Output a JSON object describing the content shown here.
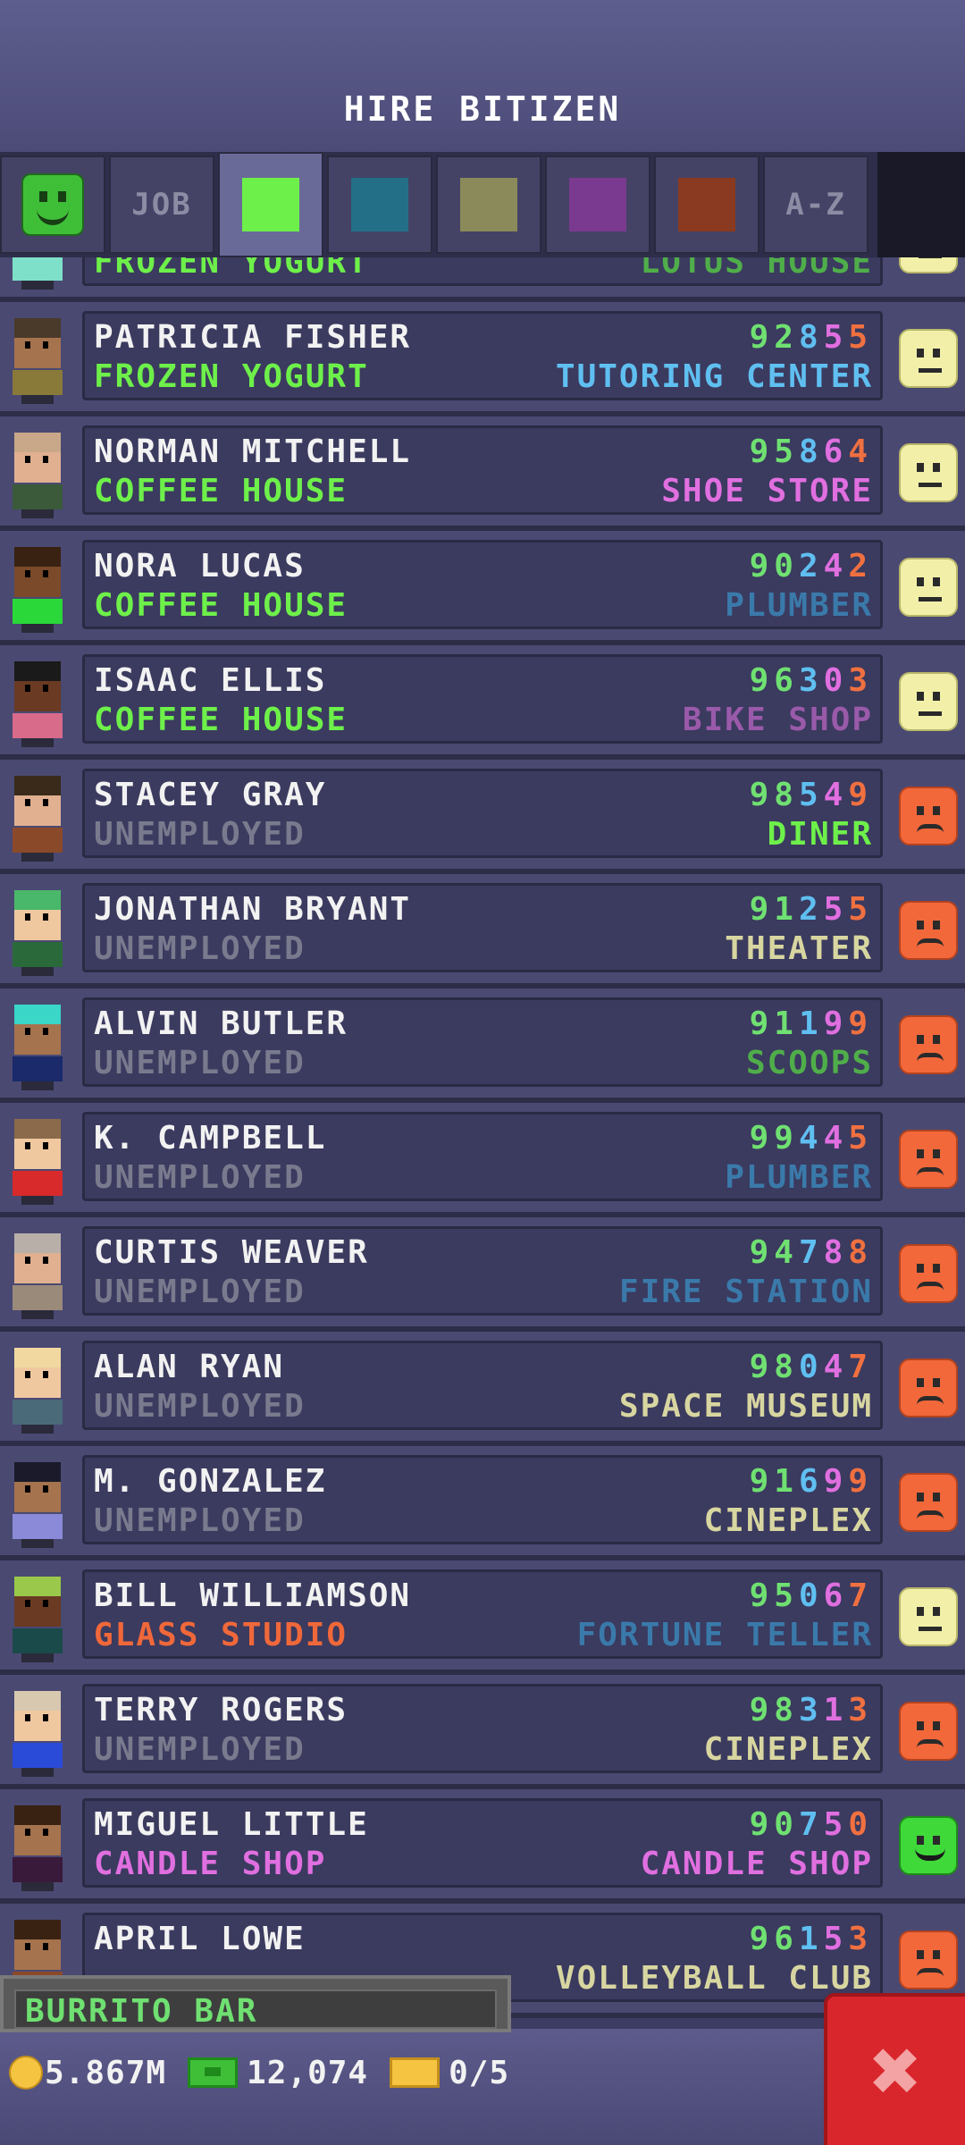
{
  "header": {
    "title": "HIRE BITIZEN"
  },
  "tabs": [
    {
      "type": "face",
      "color": "#3fbf38",
      "icon": "happy-face-icon"
    },
    {
      "type": "text",
      "label": "JOB"
    },
    {
      "type": "swatch",
      "color": "#6ef04a",
      "active": true
    },
    {
      "type": "swatch",
      "color": "#236f88"
    },
    {
      "type": "swatch",
      "color": "#8a8a5a"
    },
    {
      "type": "swatch",
      "color": "#7a3a90"
    },
    {
      "type": "swatch",
      "color": "#8a3a20"
    },
    {
      "type": "text",
      "label": "A-Z"
    }
  ],
  "rows": [
    {
      "name": "",
      "job": "FROZEN YOGURT",
      "job_color": "#6ef04a",
      "number": "",
      "dream": "LOTUS HOUSE",
      "dream_color": "#4fae4a",
      "mood": "neutral",
      "avatar": {
        "hair": "#3ad6c8",
        "skin": "#f0c8a0",
        "shirt": "#7ee0c8"
      }
    },
    {
      "name": "PATRICIA FISHER",
      "job": "FROZEN YOGURT",
      "job_color": "#6ef04a",
      "number": "92855",
      "dream": "TUTORING CENTER",
      "dream_color": "#5fbff0",
      "mood": "neutral",
      "avatar": {
        "hair": "#4a3a2a",
        "skin": "#a5734e",
        "shirt": "#8a7a3a"
      }
    },
    {
      "name": "NORMAN MITCHELL",
      "job": "COFFEE HOUSE",
      "job_color": "#6ef04a",
      "number": "95864",
      "dream": "SHOE STORE",
      "dream_color": "#e06fe0",
      "mood": "neutral",
      "avatar": {
        "hair": "#c8a888",
        "skin": "#e0b090",
        "shirt": "#3a5a3a"
      }
    },
    {
      "name": "NORA LUCAS",
      "job": "COFFEE HOUSE",
      "job_color": "#6ef04a",
      "number": "90242",
      "dream": "PLUMBER",
      "dream_color": "#3a7aaa",
      "mood": "neutral",
      "avatar": {
        "hair": "#3a2212",
        "skin": "#7a4a2a",
        "shirt": "#2ad83a"
      }
    },
    {
      "name": "ISAAC ELLIS",
      "job": "COFFEE HOUSE",
      "job_color": "#6ef04a",
      "number": "96303",
      "dream": "BIKE SHOP",
      "dream_color": "#9a5aaa",
      "mood": "neutral",
      "avatar": {
        "hair": "#1a1a1a",
        "skin": "#6a3a22",
        "shirt": "#d86a8a"
      }
    },
    {
      "name": "STACEY GRAY",
      "job": "UNEMPLOYED",
      "job_color": "#7a7a8e",
      "number": "98549",
      "dream": "DINER",
      "dream_color": "#6ef04a",
      "mood": "sad",
      "avatar": {
        "hair": "#3a2a1a",
        "skin": "#e0b090",
        "shirt": "#8a4a2a"
      }
    },
    {
      "name": "JONATHAN BRYANT",
      "job": "UNEMPLOYED",
      "job_color": "#7a7a8e",
      "number": "91255",
      "dream": "THEATER",
      "dream_color": "#d8d6a0",
      "mood": "sad",
      "avatar": {
        "hair": "#4ab86a",
        "skin": "#f0c8a0",
        "shirt": "#2a6a3a"
      }
    },
    {
      "name": "ALVIN BUTLER",
      "job": "UNEMPLOYED",
      "job_color": "#7a7a8e",
      "number": "91199",
      "dream": "SCOOPS",
      "dream_color": "#4fae4a",
      "mood": "sad",
      "avatar": {
        "hair": "#3ad6c8",
        "skin": "#a5734e",
        "shirt": "#1a2a6a"
      }
    },
    {
      "name": "K. CAMPBELL",
      "job": "UNEMPLOYED",
      "job_color": "#7a7a8e",
      "number": "99445",
      "dream": "PLUMBER",
      "dream_color": "#3a7aaa",
      "mood": "sad",
      "avatar": {
        "hair": "#8a6a4a",
        "skin": "#f0c8a0",
        "shirt": "#d82a2a"
      }
    },
    {
      "name": "CURTIS WEAVER",
      "job": "UNEMPLOYED",
      "job_color": "#7a7a8e",
      "number": "94788",
      "dream": "FIRE STATION",
      "dream_color": "#3a7aaa",
      "mood": "sad",
      "avatar": {
        "hair": "#b8b0a8",
        "skin": "#e0b090",
        "shirt": "#9a8a7a"
      }
    },
    {
      "name": "ALAN RYAN",
      "job": "UNEMPLOYED",
      "job_color": "#7a7a8e",
      "number": "98047",
      "dream": "SPACE MUSEUM",
      "dream_color": "#d8d6a0",
      "mood": "sad",
      "avatar": {
        "hair": "#f0d8a0",
        "skin": "#f0c8a0",
        "shirt": "#4a6a7a"
      }
    },
    {
      "name": "M. GONZALEZ",
      "job": "UNEMPLOYED",
      "job_color": "#7a7a8e",
      "number": "91699",
      "dream": "CINEPLEX",
      "dream_color": "#d8d6a0",
      "mood": "sad",
      "avatar": {
        "hair": "#1a1a2a",
        "skin": "#a5734e",
        "shirt": "#8a8ad8"
      }
    },
    {
      "name": "BILL WILLIAMSON",
      "job": "GLASS STUDIO",
      "job_color": "#f0683a",
      "number": "95067",
      "dream": "FORTUNE TELLER",
      "dream_color": "#3a7aaa",
      "mood": "neutral",
      "avatar": {
        "hair": "#9ac84a",
        "skin": "#6a3a22",
        "shirt": "#1a4a4a"
      }
    },
    {
      "name": "TERRY ROGERS",
      "job": "UNEMPLOYED",
      "job_color": "#7a7a8e",
      "number": "98313",
      "dream": "CINEPLEX",
      "dream_color": "#d8d6a0",
      "mood": "sad",
      "avatar": {
        "hair": "#d8c8b0",
        "skin": "#f0c8a0",
        "shirt": "#2a4ad8"
      }
    },
    {
      "name": "MIGUEL LITTLE",
      "job": "CANDLE SHOP",
      "job_color": "#e06fe0",
      "number": "90750",
      "dream": "CANDLE SHOP",
      "dream_color": "#e06fe0",
      "mood": "happy",
      "avatar": {
        "hair": "#3a2212",
        "skin": "#a5734e",
        "shirt": "#3a1a3a"
      }
    },
    {
      "name": "APRIL LOWE",
      "job": "",
      "job_color": "#7a7a8e",
      "number": "96153",
      "dream": "VOLLEYBALL CLUB",
      "dream_color": "#d8d6a0",
      "mood": "sad",
      "avatar": {
        "hair": "#3a2212",
        "skin": "#a5734e",
        "shirt": "#8a4a2a"
      }
    }
  ],
  "footer": {
    "current_job": "BURRITO BAR",
    "coins": "5.867M",
    "bux": "12,074",
    "tickets": "0/5"
  }
}
